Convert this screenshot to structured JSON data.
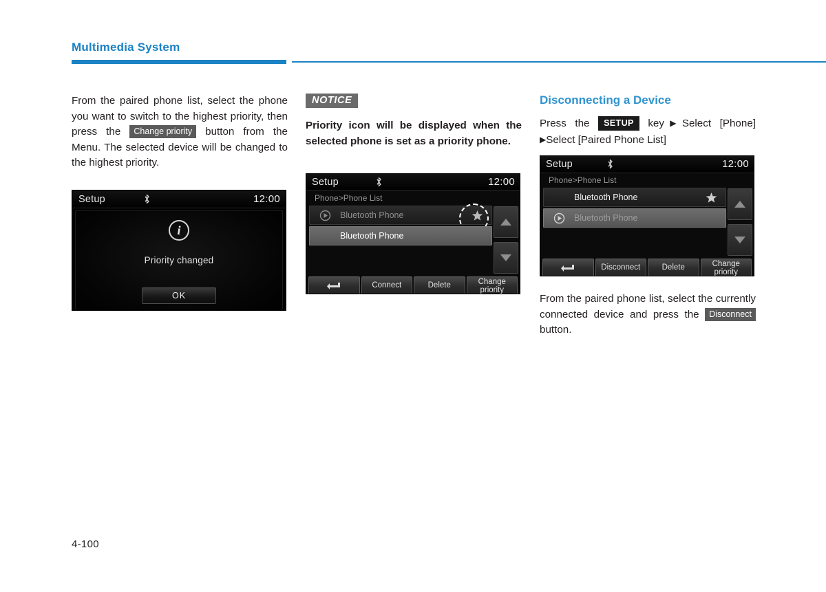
{
  "header": {
    "title": "Multimedia System",
    "accent_color": "#1b82c4"
  },
  "page_number": "4-100",
  "column1": {
    "paragraph_part1": "From the paired phone list, select the phone you want to switch to the highest priority, then press the",
    "inline_button": "Change priority",
    "paragraph_part2": "button from the Menu. The selected device will be changed to the highest priority."
  },
  "column2": {
    "notice_label": "NOTICE",
    "notice_text": "Priority icon will be displayed when the selected phone is set as a priority phone."
  },
  "column3": {
    "heading": "Disconnecting a Device",
    "steps_part1": "Press the",
    "setup_key": "SETUP",
    "steps_part2": "key",
    "arrow": "▶",
    "steps_part3": "Select [Phone]",
    "steps_part4": "Select [Paired Phone List]",
    "paragraph_part1": "From the paired phone list, select the currently connected device and press the",
    "inline_button": "Disconnect",
    "paragraph_part2": "button."
  },
  "device_priority_changed": {
    "title": "Setup",
    "bluetooth_icon": "bluetooth-icon",
    "clock": "12:00",
    "info_icon": "i",
    "message": "Priority changed",
    "ok_button": "OK"
  },
  "device_phone_list_priority": {
    "title": "Setup",
    "bluetooth_icon": "bluetooth-icon",
    "clock": "12:00",
    "breadcrumb": "Phone>Phone List",
    "rows": [
      {
        "label": "Bluetooth Phone",
        "style": "dark",
        "text": "dim",
        "has_play": true,
        "has_star": true,
        "annotated": true
      },
      {
        "label": "Bluetooth Phone",
        "style": "light",
        "text": "bright",
        "has_play": false,
        "has_star": false,
        "annotated": false
      }
    ],
    "scroll_up": "scroll-up-icon",
    "scroll_down": "scroll-down-icon",
    "toolbar": [
      {
        "label": "",
        "icon": "back-icon"
      },
      {
        "label": "Connect",
        "icon": ""
      },
      {
        "label": "Delete",
        "icon": ""
      },
      {
        "label": "Change priority",
        "icon": ""
      }
    ]
  },
  "device_phone_list_disconnect": {
    "title": "Setup",
    "bluetooth_icon": "bluetooth-icon",
    "clock": "12:00",
    "breadcrumb": "Phone>Phone List",
    "rows": [
      {
        "label": "Bluetooth Phone",
        "style": "dark",
        "text": "bright",
        "has_play": false,
        "has_star": true,
        "annotated": false
      },
      {
        "label": "Bluetooth Phone",
        "style": "light",
        "text": "dim",
        "has_play": true,
        "has_star": false,
        "annotated": false
      }
    ],
    "scroll_up": "scroll-up-icon",
    "scroll_down": "scroll-down-icon",
    "toolbar": [
      {
        "label": "",
        "icon": "back-icon"
      },
      {
        "label": "Disconnect",
        "icon": ""
      },
      {
        "label": "Delete",
        "icon": ""
      },
      {
        "label": "Change priority",
        "icon": ""
      }
    ]
  }
}
